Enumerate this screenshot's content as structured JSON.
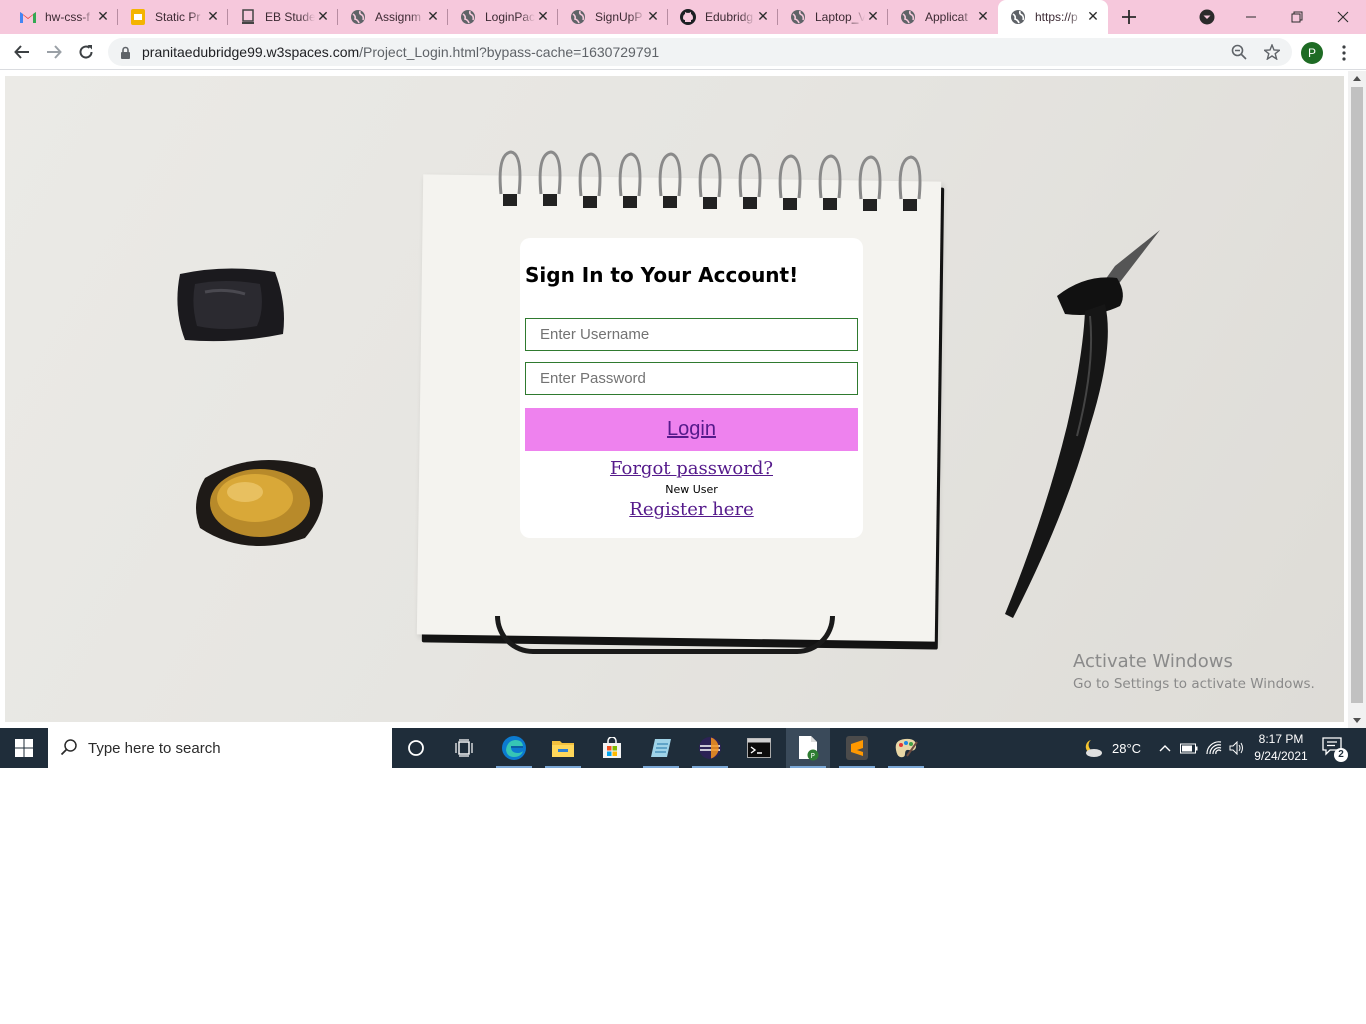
{
  "browser": {
    "tabs": [
      {
        "title": "hw-css-f",
        "icon": "gmail-icon"
      },
      {
        "title": "Static Pr",
        "icon": "slides-icon"
      },
      {
        "title": "EB Stude",
        "icon": "eb-icon"
      },
      {
        "title": "Assignm",
        "icon": "globe-icon"
      },
      {
        "title": "LoginPac",
        "icon": "globe-icon"
      },
      {
        "title": "SignUpP",
        "icon": "globe-icon"
      },
      {
        "title": "Edubridg",
        "icon": "github-icon"
      },
      {
        "title": "Laptop_V",
        "icon": "globe-icon"
      },
      {
        "title": "Applicat",
        "icon": "globe-icon"
      },
      {
        "title": "https://p",
        "icon": "globe-icon",
        "active": true
      }
    ],
    "url_host": "pranitaedubridge99.w3spaces.com",
    "url_path": "/Project_Login.html?bypass-cache=1630729791",
    "profile_initial": "P",
    "tabstrip_color": "#f6c8dc"
  },
  "login": {
    "heading": "Sign In to Your Account!",
    "username_placeholder": "Enter Username",
    "password_placeholder": "Enter Password",
    "login_label": "Login",
    "forgot_label": "Forgot password?",
    "new_user_text": "New User",
    "register_label": "Register here",
    "button_color": "#ee82ee",
    "link_color": "#551a8b",
    "input_border_color": "#2f7a2f"
  },
  "watermark": {
    "line1": "Activate Windows",
    "line2": "Go to Settings to activate Windows."
  },
  "taskbar": {
    "search_placeholder": "Type here to search",
    "temperature": "28°C",
    "time": "8:17 PM",
    "date": "9/24/2021",
    "notification_count": "2",
    "apps": [
      "cortana-icon",
      "task-view-icon",
      "edge-icon",
      "file-explorer-icon",
      "store-icon",
      "notepad-app-icon",
      "eclipse-icon",
      "terminal-icon",
      "notepadpp-icon",
      "sublime-icon",
      "paint-icon"
    ]
  }
}
